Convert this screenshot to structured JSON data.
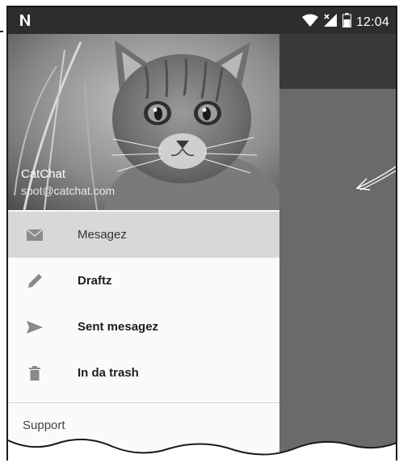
{
  "status_bar": {
    "time": "12:04",
    "logo_icon": "nougat-n-icon",
    "wifi_icon": "wifi-icon",
    "signal_icon": "no-signal-icon",
    "battery_icon": "battery-icon"
  },
  "drawer": {
    "header": {
      "app_name": "CatChat",
      "email": "spot@catchat.com"
    },
    "items": [
      {
        "label": "Mesagez",
        "icon": "mail-icon",
        "selected": true
      },
      {
        "label": "Draftz",
        "icon": "pencil-icon",
        "selected": false
      },
      {
        "label": "Sent mesagez",
        "icon": "send-icon",
        "selected": false
      },
      {
        "label": "In da trash",
        "icon": "trash-icon",
        "selected": false
      }
    ],
    "support_label": "Support"
  },
  "colors": {
    "statusbar": "#2d2d2d",
    "toolbar": "#3a3a3a",
    "scrim": "#6a6a6a",
    "drawer": "#fafafa",
    "selected": "#d8d8d8"
  }
}
